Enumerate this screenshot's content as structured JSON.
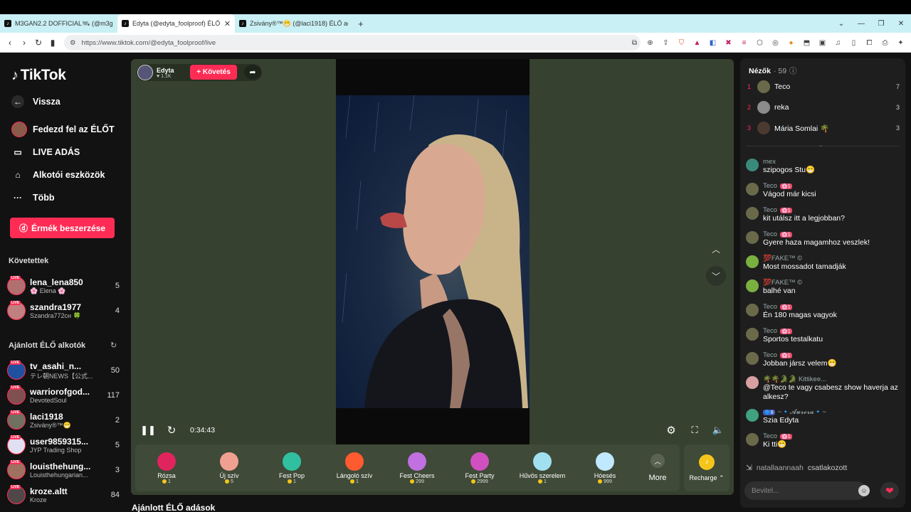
{
  "browser": {
    "tabs": [
      {
        "title": "M3GAN2.2 DOFFICIAL🛰 (@m3gan..."
      },
      {
        "title": "Edyta (@edyta_foolproof) ÉLŐ..."
      },
      {
        "title": "Zsivány®™😁 (@laci1918) ÉLŐ adás..."
      }
    ],
    "url": "https://www.tiktok.com/@edyta_foolproof/live"
  },
  "sidebar": {
    "logo": "TikTok",
    "nav": [
      {
        "label": "Vissza",
        "icon": "back-arrow-icon"
      },
      {
        "label": "Fedezd fel az ÉLŐT",
        "icon": "live-avatar-icon"
      },
      {
        "label": "LIVE ADÁS",
        "icon": "camera-icon"
      },
      {
        "label": "Alkotói eszközök",
        "icon": "house-icon"
      },
      {
        "label": "Több",
        "icon": "ellipsis-icon"
      }
    ],
    "coin_button": "Érmék beszerzése",
    "following_title": "Követettek",
    "following": [
      {
        "name": "lena_lena850",
        "sub": "🌸 Elena 🌸",
        "count": "5"
      },
      {
        "name": "szandra1977",
        "sub": "Szandra772ᴄʜ 🍀",
        "count": "4"
      }
    ],
    "suggested_title": "Ajánlott ÉLŐ alkotók",
    "suggested": [
      {
        "name": "tv_asahi_n...",
        "sub": "テレ朝NEWS【公式...",
        "count": "50"
      },
      {
        "name": "warriorofgod...",
        "sub": "DevotedSoul",
        "count": "117"
      },
      {
        "name": "laci1918",
        "sub": "Zsivány®™😁",
        "count": "2"
      },
      {
        "name": "user9859315...",
        "sub": "JYP Trading Shop",
        "count": "5"
      },
      {
        "name": "louisthehung...",
        "sub": "Louisthehungarian...",
        "count": "3"
      },
      {
        "name": "kroze.altt",
        "sub": "Kroze",
        "count": "84"
      }
    ]
  },
  "player": {
    "host_name": "Edyta",
    "host_likes": "♥ 1.1K",
    "follow_label": "+ Követés",
    "time": "0:34:43",
    "gifts": [
      {
        "name": "Rózsa",
        "price": "1",
        "color": "#e0245e"
      },
      {
        "name": "Új szív",
        "price": "5",
        "color": "#f0a090"
      },
      {
        "name": "Fest Pop",
        "price": "1",
        "color": "#30c0a0"
      },
      {
        "name": "Lángoló szív",
        "price": "1",
        "color": "#ff5a30"
      },
      {
        "name": "Fest Cheers",
        "price": "299",
        "color": "#c070e0"
      },
      {
        "name": "Fest Party",
        "price": "2999",
        "color": "#d050c0"
      },
      {
        "name": "Hűvös szerelem",
        "price": "1",
        "color": "#a0e0f0"
      },
      {
        "name": "Hóesés",
        "price": "999",
        "color": "#c0e8ff"
      }
    ],
    "more_label": "More",
    "recharge_label": "Recharge ⌃"
  },
  "suggested_lives_title": "Ajánlott ÉLŐ adások",
  "chat": {
    "viewers_title": "Nézők",
    "viewers_count": "· 59",
    "top_viewers": [
      {
        "rank": "1",
        "name": "Teco",
        "score": "7"
      },
      {
        "rank": "2",
        "name": "reka",
        "score": "3"
      },
      {
        "rank": "3",
        "name": "Mária Somlai 🌴",
        "score": "3"
      }
    ],
    "messages": [
      {
        "user": "mex",
        "badge": "",
        "text": "szipogos Stu😁",
        "color": "#3a8a7a"
      },
      {
        "user": "Teco",
        "badge": "🌸1",
        "text": "Vágod már kicsi",
        "color": "#6a6a4a"
      },
      {
        "user": "Teco",
        "badge": "🌸1",
        "text": "kit utálsz itt a legjobban?",
        "color": "#6a6a4a"
      },
      {
        "user": "Teco",
        "badge": "🌸1",
        "text": "Gyere haza magamhoz veszlek!",
        "color": "#6a6a4a"
      },
      {
        "user": "💯FAKE™ ©",
        "badge": "",
        "text": "Most mossadot tamadják",
        "color": "#7ab040"
      },
      {
        "user": "💯FAKE™ ©",
        "badge": "",
        "text": "balhé van",
        "color": "#7ab040"
      },
      {
        "user": "Teco",
        "badge": "🌸1",
        "text": "Én 180 magas vagyok",
        "color": "#6a6a4a"
      },
      {
        "user": "Teco",
        "badge": "🌸1",
        "text": "Sportos testalkatu",
        "color": "#6a6a4a"
      },
      {
        "user": "Teco",
        "badge": "🌸1",
        "text": "Jobban jársz velem😁",
        "color": "#6a6a4a"
      },
      {
        "user": "🌴🌴🐊🐊 Kittikee...",
        "badge": "",
        "text": "@Teco te vagy csabesz show haverja az alkesz?",
        "color": "#d8a0a0"
      },
      {
        "user": "~🔹𝓐𝓾𝓻𝓸𝓻𝓪🔹~",
        "badge": "🔷8",
        "text": "Szia Edyta",
        "color": "#40a080"
      },
      {
        "user": "Teco",
        "badge": "🌸1",
        "text": "Ki tti😁",
        "color": "#6a6a4a"
      }
    ],
    "joined_user": "natallaannaah",
    "joined_text": "csatlakozott",
    "input_placeholder": "Bevitel..."
  }
}
